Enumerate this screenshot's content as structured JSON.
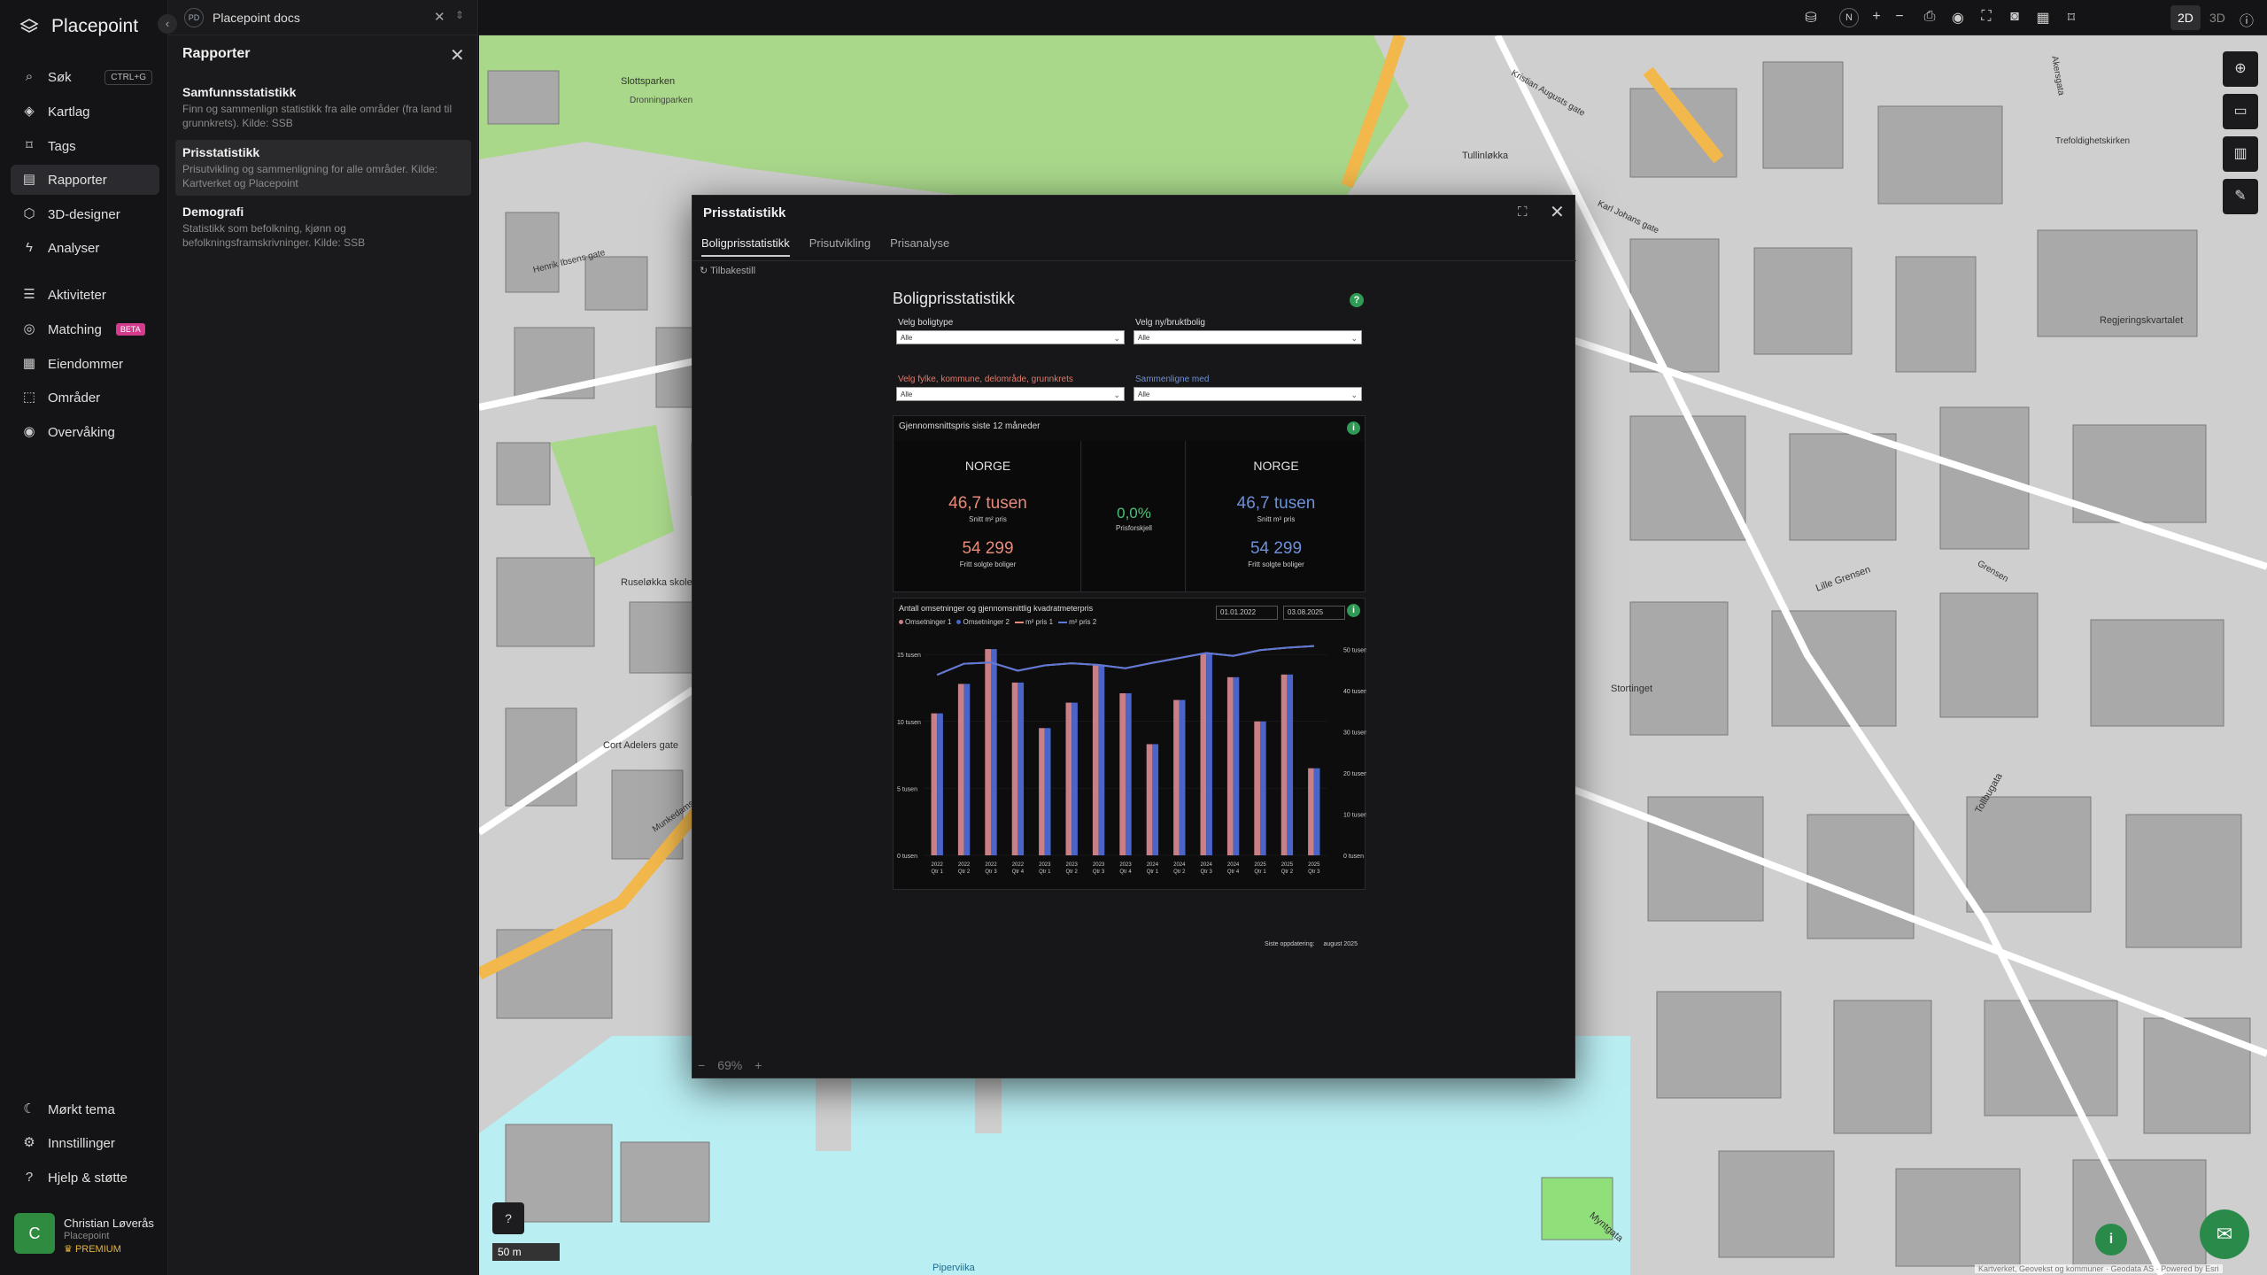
{
  "app": {
    "name": "Placepoint"
  },
  "nav": {
    "items": [
      {
        "label": "Søk",
        "icon": "search-icon",
        "kbd": "CTRL+G"
      },
      {
        "label": "Kartlag",
        "icon": "layers-icon"
      },
      {
        "label": "Tags",
        "icon": "bookmark-icon"
      },
      {
        "label": "Rapporter",
        "icon": "chart-icon"
      },
      {
        "label": "3D-designer",
        "icon": "cube-icon"
      },
      {
        "label": "Analyser",
        "icon": "bolt-icon"
      },
      {
        "label": "Aktiviteter",
        "icon": "activity-icon"
      },
      {
        "label": "Matching",
        "icon": "target-icon",
        "badge": "BETA"
      },
      {
        "label": "Eiendommer",
        "icon": "building-icon"
      },
      {
        "label": "Områder",
        "icon": "area-icon"
      },
      {
        "label": "Overvåking",
        "icon": "monitor-icon"
      }
    ],
    "bottom": [
      {
        "label": "Mørkt tema",
        "icon": "moon-icon"
      },
      {
        "label": "Innstillinger",
        "icon": "gear-icon"
      },
      {
        "label": "Hjelp & støtte",
        "icon": "help-icon"
      }
    ],
    "user": {
      "initial": "C",
      "name": "Christian Løverås",
      "org": "Placepoint",
      "plan": "PREMIUM"
    }
  },
  "doc_tab": {
    "badge": "PD",
    "label": "Placepoint docs"
  },
  "panel": {
    "title": "Rapporter",
    "reports": [
      {
        "title": "Samfunnsstatistikk",
        "desc": "Finn og sammenlign statistikk fra alle områder (fra land til grunnkrets). Kilde: SSB"
      },
      {
        "title": "Prisstatistikk",
        "desc": "Prisutvikling og sammenligning for alle områder. Kilde: Kartverket og Placepoint"
      },
      {
        "title": "Demografi",
        "desc": "Statistikk som befolkning, kjønn og befolkningsframskrivninger. Kilde: SSB"
      }
    ]
  },
  "topbar": {
    "compass": "N",
    "mode_2d": "2D",
    "mode_3d": "3D"
  },
  "map": {
    "scale": "50 m",
    "labels": [
      "Slottsparken",
      "Dronningparken",
      "Tullinløkka",
      "Henrik Ibsens gate",
      "Ruseløkka skole",
      "Cort Adelers gate",
      "Munkedamsveien",
      "Stortinget",
      "Lille Grensen",
      "Regjeringskvartalet",
      "Tollbugata",
      "Myntgata",
      "Piperviika",
      "Trefoldighetskirken",
      "Grensen",
      "Karl Johans gate",
      "Akersgata",
      "Kristian Augusts gate"
    ],
    "attribution": "Kartverket, Geovekst og kommuner · Geodata AS · Powered by Esri"
  },
  "modal": {
    "title": "Prisstatistikk",
    "tabs": [
      "Boligprisstatistikk",
      "Prisutvikling",
      "Prisanalyse"
    ],
    "reset": "Tilbakestill",
    "zoom": "69%"
  },
  "report": {
    "title": "Boligprisstatistikk",
    "filters": {
      "type_label": "Velg boligtype",
      "type_value": "Alle",
      "newused_label": "Velg ny/bruktbolig",
      "newused_value": "Alle",
      "area_label": "Velg fylke, kommune, delområde, grunnkrets",
      "area_value": "Alle",
      "compare_label": "Sammenligne med",
      "compare_value": "Alle"
    },
    "summary": {
      "header": "Gjennomsnittspris siste 12 måneder",
      "left": {
        "place": "NORGE",
        "price": "46,7 tusen",
        "price_label": "Snitt m² pris",
        "sales": "54 299",
        "sales_label": "Fritt solgte boliger"
      },
      "middle": {
        "diff": "0,0%",
        "diff_label": "Prisforskjell"
      },
      "right": {
        "place": "NORGE",
        "price": "46,7 tusen",
        "price_label": "Snitt m² pris",
        "sales": "54 299",
        "sales_label": "Fritt solgte boliger"
      }
    },
    "chart_header": "Antall omsetninger og gjennomsnittlig kvadratmeterpris",
    "date_from": "01.01.2022",
    "date_to": "03.08.2025",
    "legend": [
      "Omsetninger 1",
      "Omsetninger 2",
      "m² pris 1",
      "m² pris 2"
    ],
    "updated_label": "Siste oppdatering:",
    "updated_value": "august 2025",
    "colors": {
      "series1": "#c97f86",
      "series2": "#4a64c8",
      "price1": "#e88a7a",
      "price2": "#5c78d8"
    }
  },
  "chart_data": {
    "type": "bar",
    "title": "Antall omsetninger og gjennomsnittlig kvadratmeterpris",
    "categories": [
      "2022 Qtr 1",
      "2022 Qtr 2",
      "2022 Qtr 3",
      "2022 Qtr 4",
      "2023 Qtr 1",
      "2023 Qtr 2",
      "2023 Qtr 3",
      "2023 Qtr 4",
      "2024 Qtr 1",
      "2024 Qtr 2",
      "2024 Qtr 3",
      "2024 Qtr 4",
      "2025 Qtr 1",
      "2025 Qtr 2",
      "2025 Qtr 3"
    ],
    "series": [
      {
        "name": "Omsetninger 1",
        "values": [
          10600,
          12800,
          15400,
          12900,
          9500,
          11400,
          14200,
          12100,
          8300,
          11600,
          15100,
          13300,
          10000,
          13500,
          6500
        ]
      },
      {
        "name": "Omsetninger 2",
        "values": [
          10600,
          12800,
          15400,
          12900,
          9500,
          11400,
          14200,
          12100,
          8300,
          11600,
          15100,
          13300,
          10000,
          13500,
          6500
        ]
      },
      {
        "name": "m² pris 1",
        "values": [
          43800,
          46500,
          46800,
          44800,
          46100,
          46600,
          46200,
          45400,
          46700,
          47900,
          49100,
          48400,
          49800,
          50400,
          50800
        ]
      },
      {
        "name": "m² pris 2",
        "values": [
          43800,
          46500,
          46800,
          44800,
          46100,
          46600,
          46200,
          45400,
          46700,
          47900,
          49100,
          48400,
          49800,
          50400,
          50800
        ]
      }
    ],
    "y_left_ticks": [
      "0 tusen",
      "5 tusen",
      "10 tusen",
      "15 tusen"
    ],
    "y_right_ticks": [
      "0 tusen",
      "10 tusen",
      "20 tusen",
      "30 tusen",
      "40 tusen",
      "50 tusen"
    ],
    "ylim_left": [
      0,
      16000
    ],
    "ylim_right": [
      0,
      52000
    ],
    "legend_position": "top-left"
  }
}
